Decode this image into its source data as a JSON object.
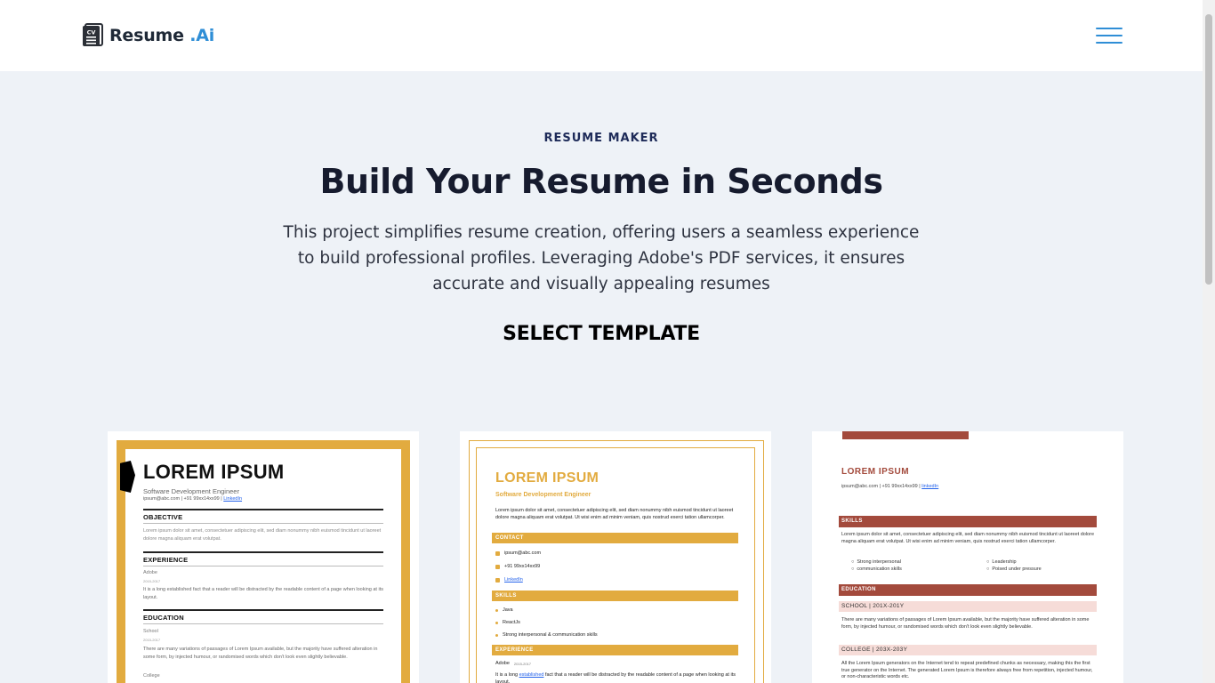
{
  "header": {
    "logo_text": "Resume",
    "logo_accent": " .Ai",
    "logo_icon": "cv-document-icon",
    "menu_icon": "hamburger-menu-icon"
  },
  "hero": {
    "eyebrow": "RESUME MAKER",
    "title": "Build Your Resume in Seconds",
    "description": "This project simplifies resume creation, offering users a seamless experience to build professional profiles. Leveraging Adobe's PDF services, it ensures accurate and visually appealing resumes",
    "select_label": "SELECT TEMPLATE"
  },
  "colors": {
    "accent_blue": "#2f8ed6",
    "gold": "#e2ab3f",
    "rust": "#a34a3c",
    "background": "#eef2f7"
  },
  "templates": [
    {
      "name": "LOREM IPSUM",
      "role": "Software Development Engineer",
      "contact": "ipsum@abc.com | +91 99xx14xx99 |",
      "linkedin": "LinkedIn",
      "objective_h": "OBJECTIVE",
      "objective": "Lorem ipsum dolor sit amet, consectetuer adipiscing elit, sed diam nonummy nibh euismod tincidunt ut laoreet dolore magna aliquam erat volutpat.",
      "experience_h": "EXPERIENCE",
      "exp_company": "Adobe",
      "exp_dates": "2015-2017",
      "exp_text": "It is a long established fact that a reader will be distracted by the readable content of a page when looking at its layout.",
      "education_h": "EDUCATION",
      "edu_school": "School",
      "edu_dates": "2015-2017",
      "edu_text": "There are many variations of passages of Lorem Ipsum available, but the majority have suffered alteration in some form, by injected humour, or randomised words which don't look even slightly believable.",
      "edu_college": "College"
    },
    {
      "name": "LOREM IPSUM",
      "role": "Software Development Engineer",
      "summary": "Lorem ipsum dolor sit amet, consectetuer adipiscing elit, sed diam nonummy nibh euismod tincidunt ut laoreet dolore magna aliquam erat volutpat. Ut wisi enim ad minim veniam, quis nostrud exerci tation ullamcorper.",
      "contact_h": "CONTACT",
      "email": "ipsum@abc.com",
      "phone": "+91 99xx14xx99",
      "linkedin": "LinkedIn",
      "skills_h": "SKILLS",
      "skills": [
        "Java",
        "ReactJs",
        "Strong interpersonal & communication skills"
      ],
      "experience_h": "EXPERIENCE",
      "exp_company": "Adobe",
      "exp_dates": "2015-2017",
      "exp_text_a": "It is a long ",
      "exp_text_link": "established",
      "exp_text_b": " fact that a reader will be distracted by the readable content of a page when looking at its layout."
    },
    {
      "name": "LOREM IPSUM",
      "contact": "ipsum@abc.com | +91 99xx14xx99 |",
      "linkedin": "linkedIn",
      "skills_h": "SKILLS",
      "skills_text": "Lorem ipsum dolor sit amet, consectetuer adipiscing elit, sed diam nonummy nibh euismod tincidunt ut laoreet dolore magna aliquam erat volutpat. Ut wisi enim ad minim veniam, quis nostrud exerci tation ullamcorper.",
      "skills_list": [
        "Strong interpersonal",
        "Leadership",
        "communication skills",
        "Poised under pressure"
      ],
      "education_h": "EDUCATION",
      "school": "SCHOOL | 201X-201Y",
      "school_text": "There are many variations of passages of Lorem Ipsum available, but the majority have suffered alteration in some form, by injected humour, or randomised words which don't look even slightly believable.",
      "college": "COLLEGE | 203X-203Y",
      "college_text": "All the Lorem Ipsum generators on the Internet tend to repeat predefined chunks as necessary, making this the first true generator on the Internet. The generated Lorem Ipsum is therefore always free from repetition, injected humour, or non-characteristic words etc."
    }
  ]
}
